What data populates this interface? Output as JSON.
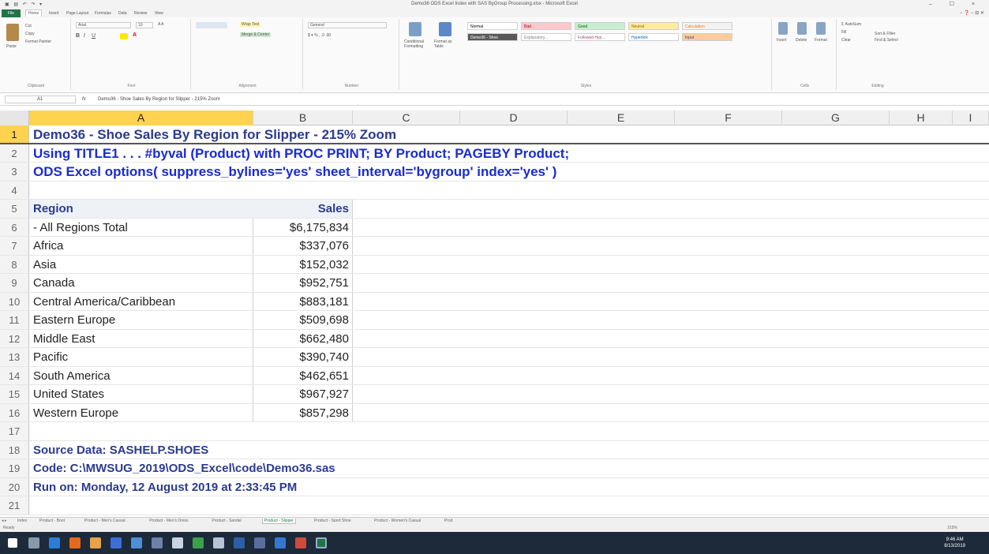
{
  "window": {
    "title": "Demo36 ODS Excel Index with SAS ByGroup Processing.xlsx - Microsoft Excel",
    "controls": "– ☐ ×"
  },
  "ribbon_tabs": [
    "File",
    "Home",
    "Insert",
    "Page Layout",
    "Formulas",
    "Data",
    "Review",
    "View"
  ],
  "ribbon": {
    "clipboard": {
      "paste": "Paste",
      "cut": "Cut",
      "copy": "Copy",
      "format_painter": "Format Painter",
      "label": "Clipboard"
    },
    "font": {
      "name": "Arial",
      "size": "10",
      "label": "Font"
    },
    "alignment": {
      "wrap_text": "Wrap Text",
      "merge": "Merge & Center",
      "label": "Alignment"
    },
    "number": {
      "format": "General",
      "label": "Number"
    },
    "styles": {
      "conditional": "Conditional Formatting",
      "format_table": "Format as Table",
      "cells": [
        {
          "text": "Normal",
          "bg": "#ffffff",
          "fg": "#000000"
        },
        {
          "text": "Bad",
          "bg": "#ffc7ce",
          "fg": "#9c0006"
        },
        {
          "text": "Good",
          "bg": "#c6efce",
          "fg": "#006100"
        },
        {
          "text": "Neutral",
          "bg": "#ffeb9c",
          "fg": "#9c6500"
        },
        {
          "text": "Calculation",
          "bg": "#f2f2f2",
          "fg": "#fa7d00"
        },
        {
          "text": "Demo36 - Shoe",
          "bg": "#595959",
          "fg": "#ffffff"
        },
        {
          "text": "Explanatory...",
          "bg": "#ffffff",
          "fg": "#7f7f7f"
        },
        {
          "text": "Followed Hyp...",
          "bg": "#ffffff",
          "fg": "#954f72"
        },
        {
          "text": "Hyperlink",
          "bg": "#ffffff",
          "fg": "#0563c1"
        },
        {
          "text": "Input",
          "bg": "#ffcc99",
          "fg": "#3f3f76"
        }
      ],
      "label": "Styles"
    },
    "cells_group": {
      "insert": "Insert",
      "delete": "Delete",
      "format": "Format",
      "label": "Cells"
    },
    "editing": {
      "autosum": "AutoSum",
      "fill": "Fill",
      "clear": "Clear",
      "sort": "Sort & Filter",
      "find": "Find & Select",
      "label": "Editing"
    }
  },
  "formula_bar": {
    "name_box": "A1",
    "fx": "fx",
    "content": "Demo36 - Shoe Sales By Region for Slipper - 215% Zoom"
  },
  "columns": [
    "A",
    "B",
    "C",
    "D",
    "E",
    "F",
    "G",
    "H",
    "I"
  ],
  "rows": [
    "1",
    "2",
    "3",
    "4",
    "5",
    "6",
    "7",
    "8",
    "9",
    "10",
    "11",
    "12",
    "13",
    "14",
    "15",
    "16",
    "17",
    "18",
    "19",
    "20",
    "21"
  ],
  "sheet": {
    "title": "Demo36 - Shoe Sales By Region for Slipper - 215% Zoom",
    "line2": "Using TITLE1 . . . #byval (Product) with PROC PRINT; BY Product; PAGEBY Product;",
    "line3": "ODS Excel options( suppress_bylines='yes' sheet_interval='bygroup' index='yes' )",
    "table_header": {
      "region": "Region",
      "sales": "Sales"
    },
    "table_rows": [
      {
        "region": "- All Regions Total",
        "sales": "$6,175,834"
      },
      {
        "region": "Africa",
        "sales": "$337,076"
      },
      {
        "region": "Asia",
        "sales": "$152,032"
      },
      {
        "region": "Canada",
        "sales": "$952,751"
      },
      {
        "region": "Central America/Caribbean",
        "sales": "$883,181"
      },
      {
        "region": "Eastern Europe",
        "sales": "$509,698"
      },
      {
        "region": "Middle East",
        "sales": "$662,480"
      },
      {
        "region": "Pacific",
        "sales": "$390,740"
      },
      {
        "region": "South America",
        "sales": "$462,651"
      },
      {
        "region": "United States",
        "sales": "$967,927"
      },
      {
        "region": "Western Europe",
        "sales": "$857,298"
      }
    ],
    "footer": {
      "source": "Source Data: SASHELP.SHOES",
      "code": "Code: C:\\MWSUG_2019\\ODS_Excel\\code\\Demo36.sas",
      "run": "Run on: Monday, 12 August 2019 at 2:33:45 PM"
    }
  },
  "sheet_tabs": [
    "Index",
    "Product - Boot",
    "Product - Men's Casual",
    "Product - Men's Dress",
    "Product - Sandal",
    "Product - Slipper",
    "Product - Sport Shoe",
    "Product - Women's Casual",
    "Prod"
  ],
  "active_sheet_tab": "Product - Slipper",
  "status": {
    "ready": "Ready",
    "zoom": "215%"
  },
  "clock": {
    "time": "9:46 AM",
    "date": "8/13/2019"
  },
  "colors": {
    "title_blue": "#1a2bd0",
    "navy": "#2b3a8f",
    "header_bg": "#eef2f7",
    "excel_green": "#217346",
    "selected_header": "#ffd250"
  }
}
